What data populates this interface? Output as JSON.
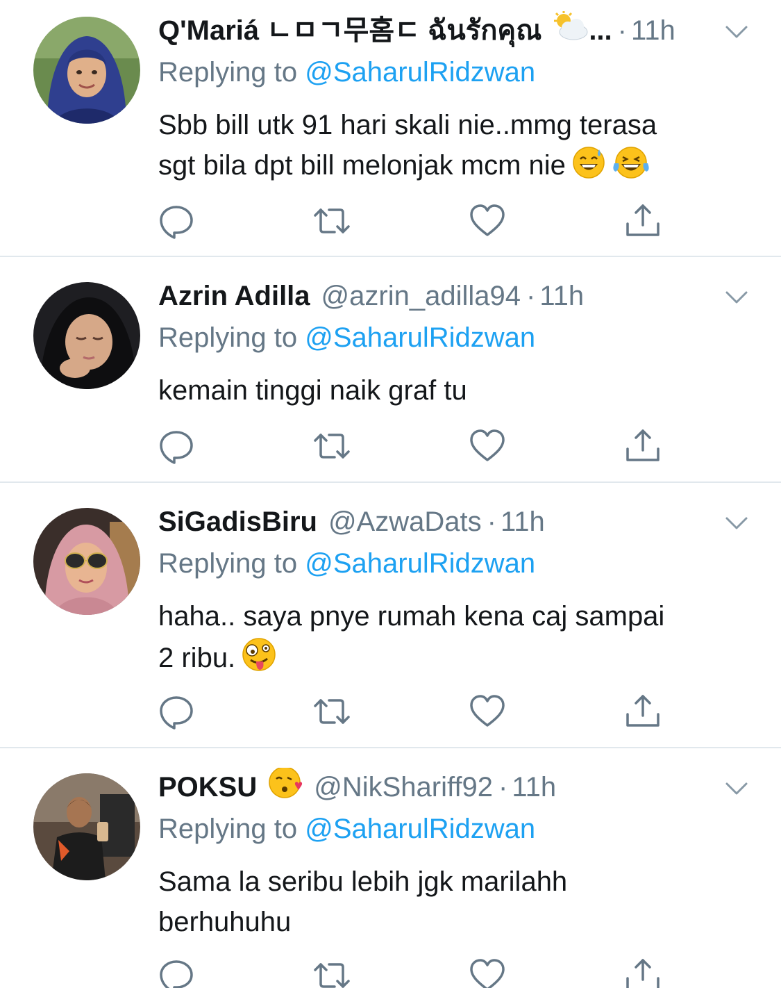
{
  "tweets": [
    {
      "name": "Q'Mariá ㄴㅁㄱ무홈ㄷ ฉันรักคุณ",
      "name_emoji": "sun-behind-cloud",
      "name_ellipsis": "...",
      "handle": "",
      "separator": "·",
      "time": "11h",
      "replying_prefix": "Replying to",
      "replying_to": "@SaharulRidzwan",
      "text_lines": [
        "Sbb bill utk 91 hari skali nie..mmg terasa",
        "sgt bila dpt bill melonjak mcm nie"
      ],
      "text_emojis": [
        "grinning-sweat-emoji",
        "tears-of-joy-emoji"
      ],
      "avatar": "woman-blue-hijab-avatar"
    },
    {
      "name": "Azrin Adilla",
      "handle": "@azrin_adilla94",
      "separator": "·",
      "time": "11h",
      "replying_prefix": "Replying to",
      "replying_to": "@SaharulRidzwan",
      "text_lines": [
        "kemain tinggi naik graf tu"
      ],
      "avatar": "woman-black-hijab-avatar"
    },
    {
      "name": "SiGadisBiru",
      "handle": "@AzwaDats",
      "separator": "·",
      "time": "11h",
      "replying_prefix": "Replying to",
      "replying_to": "@SaharulRidzwan",
      "text_lines": [
        "haha.. saya pnye rumah kena caj sampai",
        "2 ribu."
      ],
      "text_emojis": [
        "zany-face-emoji"
      ],
      "avatar": "woman-pink-hijab-sunglasses-avatar"
    },
    {
      "name": "POKSU",
      "name_emoji": "face-blowing-kiss",
      "handle": "@NikShariff92",
      "separator": "·",
      "time": "11h",
      "replying_prefix": "Replying to",
      "replying_to": "@SaharulRidzwan",
      "text_lines": [
        "Sama la seribu lebih jgk marilahh",
        "berhuhuhu"
      ],
      "avatar": "man-gym-selfie-avatar"
    }
  ],
  "actions": [
    "reply-icon",
    "retweet-icon",
    "like-icon",
    "share-icon"
  ],
  "colors": {
    "text": "#14171a",
    "secondary": "#657786",
    "link": "#1da1f2",
    "divider": "#e1e8ed"
  }
}
